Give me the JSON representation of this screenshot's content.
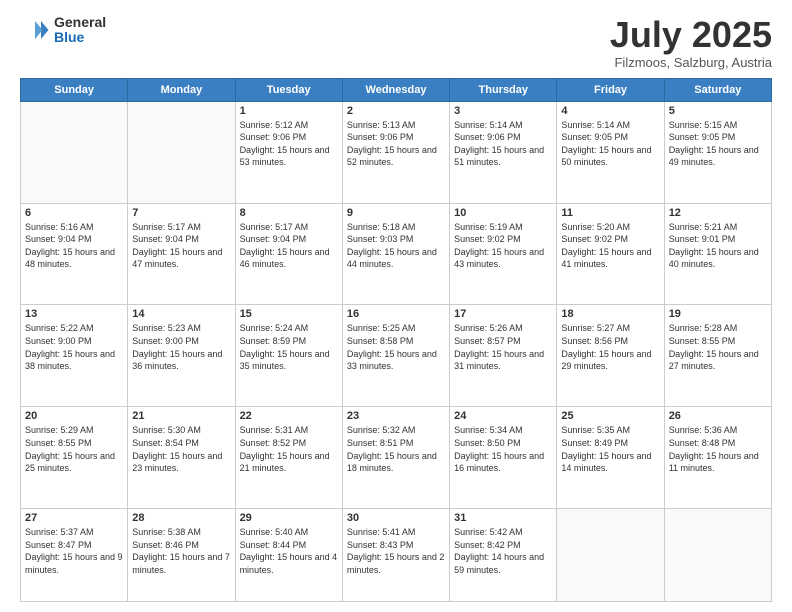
{
  "header": {
    "logo_general": "General",
    "logo_blue": "Blue",
    "month_title": "July 2025",
    "subtitle": "Filzmoos, Salzburg, Austria"
  },
  "days_of_week": [
    "Sunday",
    "Monday",
    "Tuesday",
    "Wednesday",
    "Thursday",
    "Friday",
    "Saturday"
  ],
  "weeks": [
    [
      {
        "day": "",
        "sunrise": "",
        "sunset": "",
        "daylight": ""
      },
      {
        "day": "",
        "sunrise": "",
        "sunset": "",
        "daylight": ""
      },
      {
        "day": "1",
        "sunrise": "Sunrise: 5:12 AM",
        "sunset": "Sunset: 9:06 PM",
        "daylight": "Daylight: 15 hours and 53 minutes."
      },
      {
        "day": "2",
        "sunrise": "Sunrise: 5:13 AM",
        "sunset": "Sunset: 9:06 PM",
        "daylight": "Daylight: 15 hours and 52 minutes."
      },
      {
        "day": "3",
        "sunrise": "Sunrise: 5:14 AM",
        "sunset": "Sunset: 9:06 PM",
        "daylight": "Daylight: 15 hours and 51 minutes."
      },
      {
        "day": "4",
        "sunrise": "Sunrise: 5:14 AM",
        "sunset": "Sunset: 9:05 PM",
        "daylight": "Daylight: 15 hours and 50 minutes."
      },
      {
        "day": "5",
        "sunrise": "Sunrise: 5:15 AM",
        "sunset": "Sunset: 9:05 PM",
        "daylight": "Daylight: 15 hours and 49 minutes."
      }
    ],
    [
      {
        "day": "6",
        "sunrise": "Sunrise: 5:16 AM",
        "sunset": "Sunset: 9:04 PM",
        "daylight": "Daylight: 15 hours and 48 minutes."
      },
      {
        "day": "7",
        "sunrise": "Sunrise: 5:17 AM",
        "sunset": "Sunset: 9:04 PM",
        "daylight": "Daylight: 15 hours and 47 minutes."
      },
      {
        "day": "8",
        "sunrise": "Sunrise: 5:17 AM",
        "sunset": "Sunset: 9:04 PM",
        "daylight": "Daylight: 15 hours and 46 minutes."
      },
      {
        "day": "9",
        "sunrise": "Sunrise: 5:18 AM",
        "sunset": "Sunset: 9:03 PM",
        "daylight": "Daylight: 15 hours and 44 minutes."
      },
      {
        "day": "10",
        "sunrise": "Sunrise: 5:19 AM",
        "sunset": "Sunset: 9:02 PM",
        "daylight": "Daylight: 15 hours and 43 minutes."
      },
      {
        "day": "11",
        "sunrise": "Sunrise: 5:20 AM",
        "sunset": "Sunset: 9:02 PM",
        "daylight": "Daylight: 15 hours and 41 minutes."
      },
      {
        "day": "12",
        "sunrise": "Sunrise: 5:21 AM",
        "sunset": "Sunset: 9:01 PM",
        "daylight": "Daylight: 15 hours and 40 minutes."
      }
    ],
    [
      {
        "day": "13",
        "sunrise": "Sunrise: 5:22 AM",
        "sunset": "Sunset: 9:00 PM",
        "daylight": "Daylight: 15 hours and 38 minutes."
      },
      {
        "day": "14",
        "sunrise": "Sunrise: 5:23 AM",
        "sunset": "Sunset: 9:00 PM",
        "daylight": "Daylight: 15 hours and 36 minutes."
      },
      {
        "day": "15",
        "sunrise": "Sunrise: 5:24 AM",
        "sunset": "Sunset: 8:59 PM",
        "daylight": "Daylight: 15 hours and 35 minutes."
      },
      {
        "day": "16",
        "sunrise": "Sunrise: 5:25 AM",
        "sunset": "Sunset: 8:58 PM",
        "daylight": "Daylight: 15 hours and 33 minutes."
      },
      {
        "day": "17",
        "sunrise": "Sunrise: 5:26 AM",
        "sunset": "Sunset: 8:57 PM",
        "daylight": "Daylight: 15 hours and 31 minutes."
      },
      {
        "day": "18",
        "sunrise": "Sunrise: 5:27 AM",
        "sunset": "Sunset: 8:56 PM",
        "daylight": "Daylight: 15 hours and 29 minutes."
      },
      {
        "day": "19",
        "sunrise": "Sunrise: 5:28 AM",
        "sunset": "Sunset: 8:55 PM",
        "daylight": "Daylight: 15 hours and 27 minutes."
      }
    ],
    [
      {
        "day": "20",
        "sunrise": "Sunrise: 5:29 AM",
        "sunset": "Sunset: 8:55 PM",
        "daylight": "Daylight: 15 hours and 25 minutes."
      },
      {
        "day": "21",
        "sunrise": "Sunrise: 5:30 AM",
        "sunset": "Sunset: 8:54 PM",
        "daylight": "Daylight: 15 hours and 23 minutes."
      },
      {
        "day": "22",
        "sunrise": "Sunrise: 5:31 AM",
        "sunset": "Sunset: 8:52 PM",
        "daylight": "Daylight: 15 hours and 21 minutes."
      },
      {
        "day": "23",
        "sunrise": "Sunrise: 5:32 AM",
        "sunset": "Sunset: 8:51 PM",
        "daylight": "Daylight: 15 hours and 18 minutes."
      },
      {
        "day": "24",
        "sunrise": "Sunrise: 5:34 AM",
        "sunset": "Sunset: 8:50 PM",
        "daylight": "Daylight: 15 hours and 16 minutes."
      },
      {
        "day": "25",
        "sunrise": "Sunrise: 5:35 AM",
        "sunset": "Sunset: 8:49 PM",
        "daylight": "Daylight: 15 hours and 14 minutes."
      },
      {
        "day": "26",
        "sunrise": "Sunrise: 5:36 AM",
        "sunset": "Sunset: 8:48 PM",
        "daylight": "Daylight: 15 hours and 11 minutes."
      }
    ],
    [
      {
        "day": "27",
        "sunrise": "Sunrise: 5:37 AM",
        "sunset": "Sunset: 8:47 PM",
        "daylight": "Daylight: 15 hours and 9 minutes."
      },
      {
        "day": "28",
        "sunrise": "Sunrise: 5:38 AM",
        "sunset": "Sunset: 8:46 PM",
        "daylight": "Daylight: 15 hours and 7 minutes."
      },
      {
        "day": "29",
        "sunrise": "Sunrise: 5:40 AM",
        "sunset": "Sunset: 8:44 PM",
        "daylight": "Daylight: 15 hours and 4 minutes."
      },
      {
        "day": "30",
        "sunrise": "Sunrise: 5:41 AM",
        "sunset": "Sunset: 8:43 PM",
        "daylight": "Daylight: 15 hours and 2 minutes."
      },
      {
        "day": "31",
        "sunrise": "Sunrise: 5:42 AM",
        "sunset": "Sunset: 8:42 PM",
        "daylight": "Daylight: 14 hours and 59 minutes."
      },
      {
        "day": "",
        "sunrise": "",
        "sunset": "",
        "daylight": ""
      },
      {
        "day": "",
        "sunrise": "",
        "sunset": "",
        "daylight": ""
      }
    ]
  ]
}
